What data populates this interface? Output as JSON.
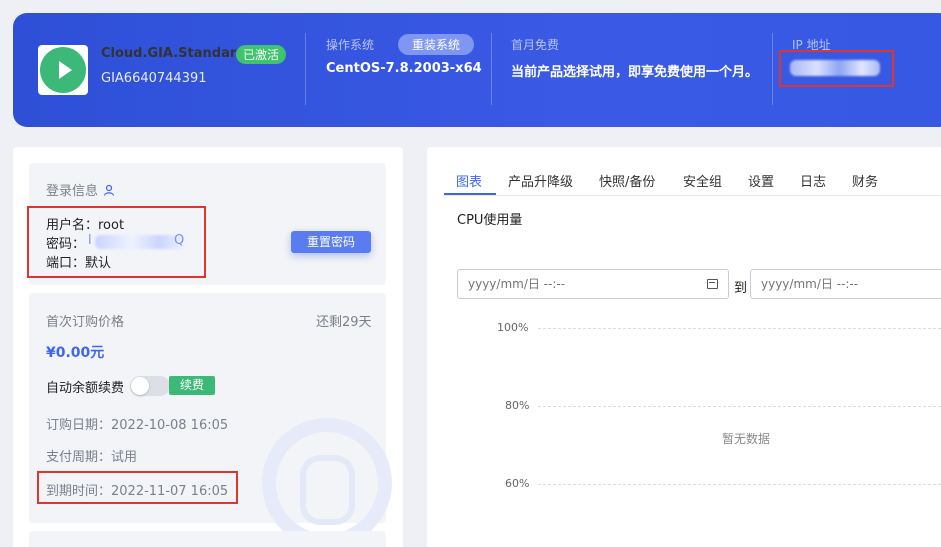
{
  "header": {
    "product_name": "Cloud.GIA.Standard",
    "status_badge": "已激活",
    "product_id": "GIA6640744391",
    "os_label": "操作系统",
    "reinstall_button": "重装系统",
    "os_value": "CentOS-7.8.2003-x64",
    "promo_label": "首月免费",
    "promo_text": "当前产品选择试用，即享免费使用一个月。",
    "ip_label": "IP 地址"
  },
  "login_info": {
    "title": "登录信息",
    "username": "用户名：root",
    "password_label": "密码：",
    "password_prefix": "l",
    "password_suffix": "Q",
    "port": "端口：默认",
    "reset_button": "重置密码"
  },
  "billing": {
    "first_price_label": "首次订购价格",
    "remaining": "还剩29天",
    "price": "¥0.00元",
    "auto_renew_label": "自动余额续费",
    "auto_renew_enabled": false,
    "renew_button": "续费",
    "order_date": "订购日期：2022-10-08 16:05",
    "pay_cycle": "支付周期：试用",
    "expire_time": "到期时间：2022-11-07 16:05"
  },
  "tabs": [
    {
      "label": "图表",
      "active": true
    },
    {
      "label": "产品升降级"
    },
    {
      "label": "快照/备份"
    },
    {
      "label": "安全组"
    },
    {
      "label": "设置"
    },
    {
      "label": "日志"
    },
    {
      "label": "财务"
    }
  ],
  "chart": {
    "title": "CPU使用量",
    "start_placeholder": "yyyy/mm/日 --:--",
    "to_label": "到",
    "end_placeholder": "yyyy/mm/日 --:--",
    "y_ticks": [
      "100%",
      "80%",
      "60%"
    ],
    "no_data": "暂无数据"
  },
  "colors": {
    "banner": "#3556e0",
    "accent": "#3d66f0",
    "success": "#3cb878",
    "highlight_box": "#e0352b"
  }
}
